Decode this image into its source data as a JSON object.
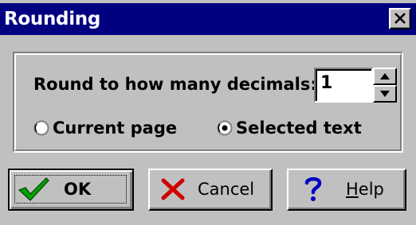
{
  "window": {
    "title": "Rounding",
    "close_icon": "close-icon"
  },
  "group": {
    "round_label": "Round to how many decimals:",
    "decimals_value": "1",
    "spin_up_icon": "arrow-up-icon",
    "spin_down_icon": "arrow-down-icon"
  },
  "scope": {
    "options": [
      {
        "label": "Current page",
        "selected": false
      },
      {
        "label": "Selected text",
        "selected": true
      }
    ]
  },
  "buttons": {
    "ok": {
      "label": "OK",
      "icon": "checkmark-icon",
      "color": "#008000"
    },
    "cancel": {
      "label": "Cancel",
      "icon": "x-icon",
      "color": "#d00000"
    },
    "help": {
      "label": "Help",
      "icon": "question-mark-icon",
      "color": "#0000c0"
    }
  },
  "colors": {
    "title_bar": "#000080",
    "dialog_face": "#c0c0c0"
  }
}
